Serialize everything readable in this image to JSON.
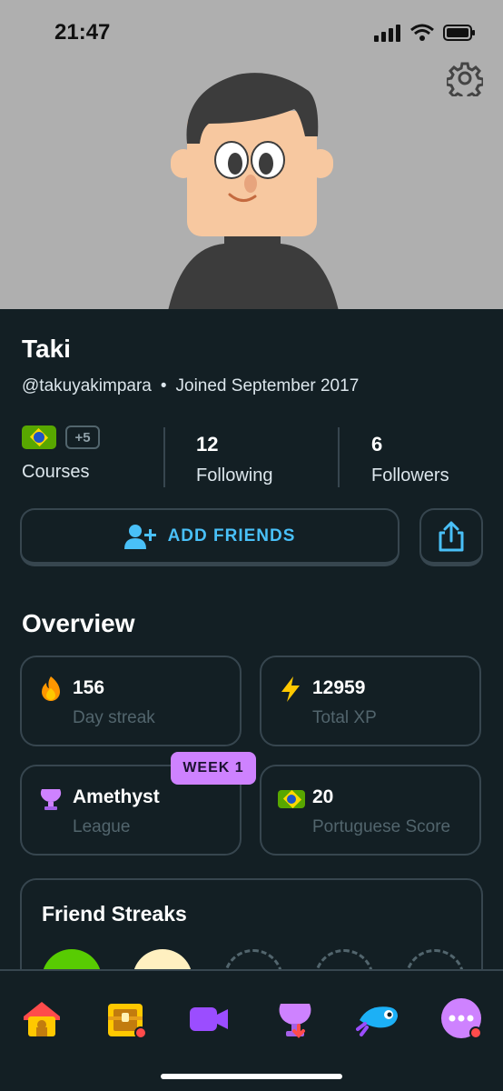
{
  "status_bar": {
    "time": "21:47"
  },
  "profile": {
    "name": "Taki",
    "handle": "@takuyakimpara",
    "separator": "•",
    "joined": "Joined September 2017"
  },
  "stats": {
    "courses_extra": "+5",
    "courses_label": "Courses",
    "following_count": "12",
    "following_label": "Following",
    "followers_count": "6",
    "followers_label": "Followers"
  },
  "actions": {
    "add_friends_label": "ADD FRIENDS"
  },
  "overview": {
    "title": "Overview",
    "streak_value": "156",
    "streak_label": "Day streak",
    "xp_value": "12959",
    "xp_label": "Total XP",
    "league_value": "Amethyst",
    "league_label": "League",
    "week_badge": "WEEK 1",
    "score_value": "20",
    "score_label": "Portuguese Score"
  },
  "friend_streaks": {
    "title": "Friend Streaks"
  },
  "icons": {
    "settings": "gear-icon",
    "add_friend": "add-person-icon",
    "share": "share-icon",
    "streak": "flame-icon",
    "xp": "lightning-icon",
    "league": "amethyst-trophy-icon",
    "course_flag": "brazil-flag-icon",
    "tabs": [
      "home-icon",
      "chest-icon",
      "video-icon",
      "league-icon",
      "bird-icon",
      "more-icon"
    ]
  },
  "colors": {
    "background": "#131f24",
    "accent_blue": "#49c0f8",
    "league_purple": "#ce82ff",
    "border": "#37464f",
    "hero_gray": "#afafaf"
  }
}
